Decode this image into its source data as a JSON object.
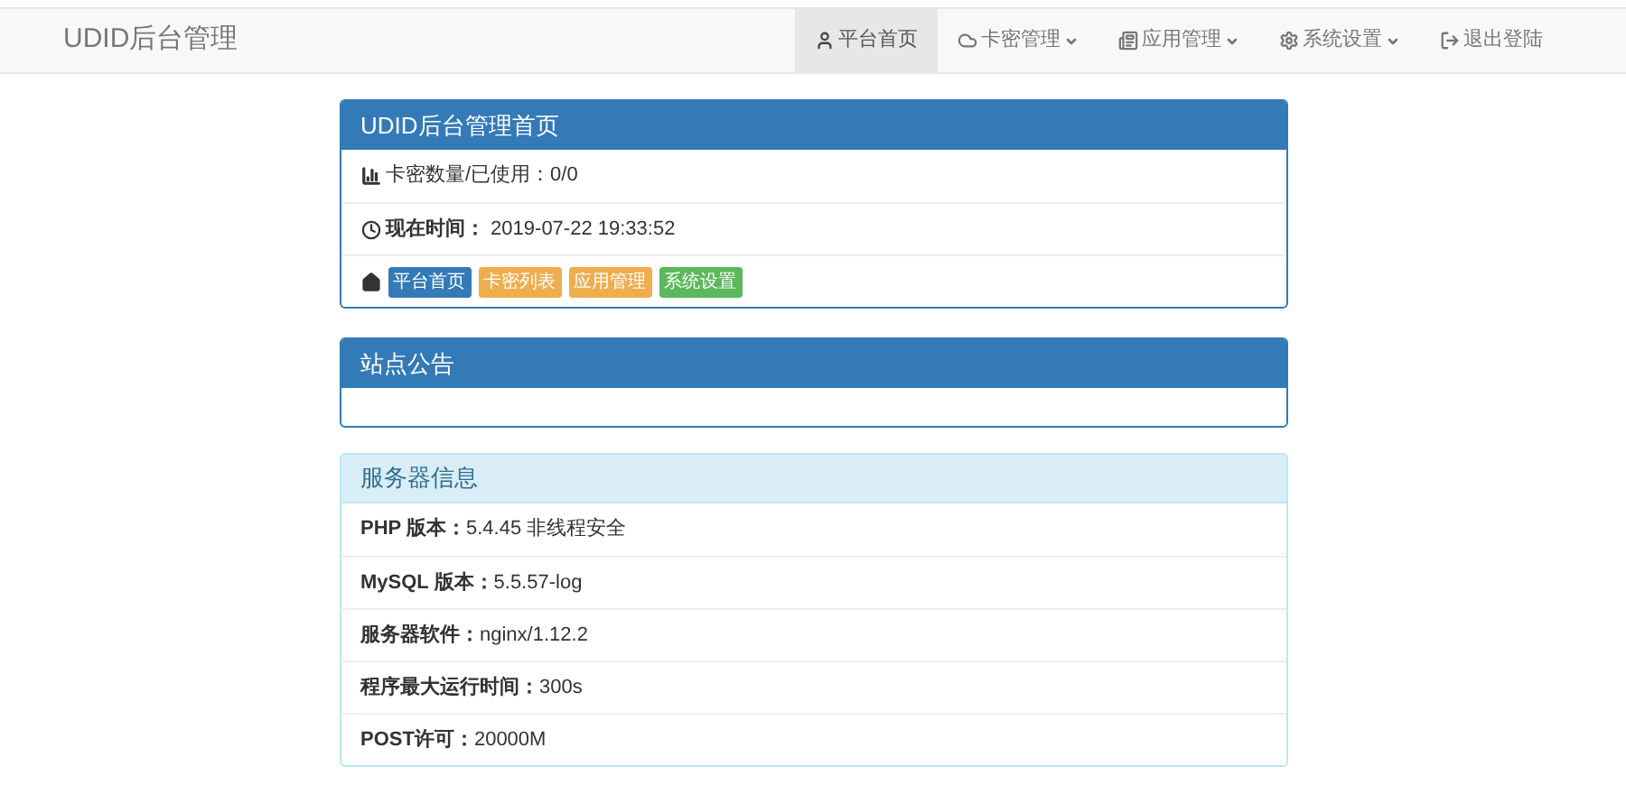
{
  "navbar": {
    "brand": "UDID后台管理",
    "items": [
      {
        "kind": "user",
        "label": "平台首页",
        "selected": true,
        "dropdown": false
      },
      {
        "kind": "cloud",
        "label": "卡密管理",
        "selected": false,
        "dropdown": true
      },
      {
        "kind": "list",
        "label": "应用管理",
        "selected": false,
        "dropdown": true
      },
      {
        "kind": "gear",
        "label": "系统设置",
        "selected": false,
        "dropdown": true
      },
      {
        "kind": "logout",
        "label": "退出登陆",
        "selected": false,
        "dropdown": false
      }
    ]
  },
  "home_panel": {
    "title": "UDID后台管理首页",
    "rows": [
      {
        "kind": "stat",
        "text": "卡密数量/已使用：0/0"
      },
      {
        "kind": "time",
        "text": "**现在时间：** 2019-07-22 19:33:52"
      },
      {
        "kind": "links",
        "links": [
          {
            "label": "平台首页",
            "color": "#337ab7"
          },
          {
            "label": "卡密列表",
            "color": "#f0ad4e"
          },
          {
            "label": "应用管理",
            "color": "#f0ad4e"
          },
          {
            "label": "系统设置",
            "color": "#5cb85c"
          }
        ]
      }
    ]
  },
  "notice_panel": {
    "title": "站点公告"
  },
  "server_panel": {
    "title": "服务器信息",
    "rows": [
      "**PHP 版本：**5.4.45 非线程安全",
      "**MySQL 版本：**5.5.57-log",
      "**服务器软件：**nginx/1.12.2",
      "**程序最大运行时间：**300s",
      "**POST许可：**20000M"
    ]
  }
}
